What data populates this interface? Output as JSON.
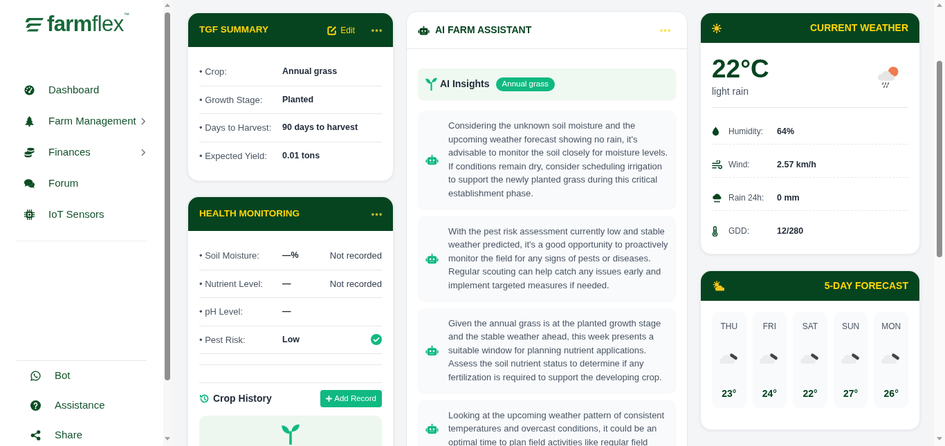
{
  "logo": {
    "text": "**farm**flex$^{™}$"
  },
  "sidebar": {
    "items": [
      {
        "label": "Dashboard",
        "has_submenu": false
      },
      {
        "label": "Farm Management",
        "has_submenu": true
      },
      {
        "label": "Finances",
        "has_submenu": true
      },
      {
        "label": "Forum",
        "has_submenu": false
      },
      {
        "label": "IoT Sensors",
        "has_submenu": false
      }
    ],
    "footer_items": [
      {
        "label": "Bot"
      },
      {
        "label": "Assistance"
      },
      {
        "label": "Share"
      }
    ]
  },
  "tgf_summary": {
    "title": "TGF SUMMARY",
    "edit_label": "Edit",
    "rows": [
      {
        "label": "• Crop:",
        "value": "Annual grass"
      },
      {
        "label": "• Growth Stage:",
        "value": "Planted"
      },
      {
        "label": "• Days to Harvest:",
        "value": "90 days to harvest"
      },
      {
        "label": "• Expected Yield:",
        "value": "0.01 tons"
      }
    ]
  },
  "health_monitoring": {
    "title": "HEALTH MONITORING",
    "rows": [
      {
        "label": "• Soil Moisture:",
        "value": "—%",
        "status": "Not recorded",
        "ok": false
      },
      {
        "label": "• Nutrient Level:",
        "value": "—",
        "status": "Not recorded",
        "ok": false
      },
      {
        "label": "• pH Level:",
        "value": "—",
        "ok": false
      },
      {
        "label": "• Pest Risk:",
        "value": "Low",
        "ok": true
      }
    ],
    "crop_history": {
      "title": "Crop History",
      "add_button": "Add Record"
    }
  },
  "ai_assistant": {
    "title": "AI FARM ASSISTANT",
    "insights_title": "AI Insights",
    "crop_badge": "Annual grass",
    "insights": [
      "Considering the unknown soil moisture and the upcoming weather forecast showing no rain, it's advisable to monitor the soil closely for moisture levels. If conditions remain dry, consider scheduling irrigation to support the newly planted grass during this critical establishment phase.",
      "With the pest risk assessment currently low and stable weather predicted, it's a good opportunity to proactively monitor the field for any signs of pests or diseases. Regular scouting can help catch any issues early and implement targeted measures if needed.",
      "Given the annual grass is at the planted growth stage and the stable weather ahead, this week presents a suitable window for planning nutrient applications. Assess the soil nutrient status to determine if any fertilization is required to support the developing crop.",
      "Looking at the upcoming weather pattern of consistent temperatures and overcast conditions, it could be an optimal time to plan field activities like regular field"
    ]
  },
  "current_weather": {
    "title": "CURRENT WEATHER",
    "temperature": "22°C",
    "condition": "light rain",
    "details": [
      {
        "label": "Humidity:",
        "value": "64%"
      },
      {
        "label": "Wind:",
        "value": "2.57 km/h"
      },
      {
        "label": "Rain 24h:",
        "value": "0 mm"
      },
      {
        "label": "GDD:",
        "value": "12/280"
      }
    ]
  },
  "forecast": {
    "title": "5-DAY FORECAST",
    "days": [
      {
        "day": "THU",
        "temp": "23°"
      },
      {
        "day": "FRI",
        "temp": "24°"
      },
      {
        "day": "SAT",
        "temp": "22°"
      },
      {
        "day": "SUN",
        "temp": "27°"
      },
      {
        "day": "MON",
        "temp": "26°"
      }
    ]
  }
}
